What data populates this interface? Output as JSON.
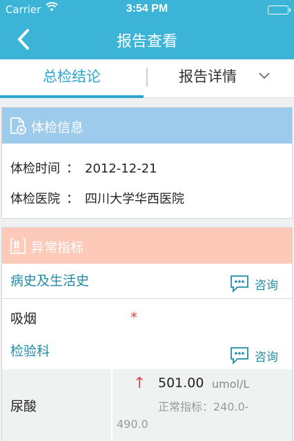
{
  "status_bar": {
    "carrier": "Carrier",
    "time": "3:54 PM"
  },
  "nav": {
    "title": "报告查看"
  },
  "tabs": [
    {
      "label": "总检结论",
      "active": true
    },
    {
      "label": "报告详情",
      "active": false
    }
  ],
  "exam_info": {
    "header": "体检信息",
    "rows": [
      {
        "label": "体检时间",
        "colon": "：",
        "value": "2012-12-21"
      },
      {
        "label": "体检医院",
        "colon": "：",
        "value": "四川大学华西医院"
      }
    ]
  },
  "abnormal": {
    "header": "异常指标",
    "sections": [
      {
        "title": "病史及生活史",
        "consult_label": "咨询"
      },
      {
        "title": "检验科",
        "consult_label": "咨询"
      }
    ],
    "items": [
      {
        "name": "吸烟",
        "mark": "*"
      }
    ],
    "results": [
      {
        "name": "尿酸",
        "arrow": "↑",
        "value": "501.00",
        "unit": "umol/L",
        "normal": "正常指标：240.0-490.0"
      }
    ]
  },
  "colors": {
    "primary": "#3bb4d8",
    "tab_active": "#2aa5cf",
    "info_header": "#9ccbec",
    "abnormal_header": "#fdc9b8",
    "section_text": "#1f8ba8",
    "alert": "#e05050"
  }
}
